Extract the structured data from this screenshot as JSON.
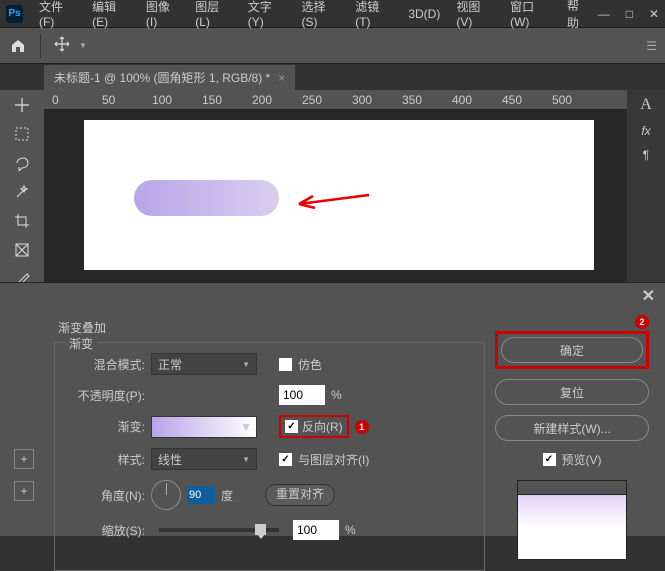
{
  "menu": {
    "file": "文件(F)",
    "edit": "编辑(E)",
    "image": "图像(I)",
    "layer": "图层(L)",
    "text": "文字(Y)",
    "select": "选择(S)",
    "filter": "滤镜(T)",
    "three_d": "3D(D)",
    "view": "视图(V)",
    "window": "窗口(W)",
    "help": "帮助"
  },
  "ps": "Ps",
  "tab_title": "未标题-1 @ 100% (圆角矩形 1, RGB/8) *",
  "ruler": {
    "r0": "0",
    "r50": "50",
    "r100": "100",
    "r150": "150",
    "r200": "200",
    "r250": "250",
    "r300": "300",
    "r350": "350",
    "r400": "400",
    "r450": "450",
    "r500": "500"
  },
  "right_icons": {
    "type": "A",
    "fx": "fx",
    "para": "¶"
  },
  "dialog": {
    "title": "渐变叠加",
    "legend": "渐变",
    "blend_mode_label": "混合模式:",
    "blend_mode_value": "正常",
    "dither_label": "仿色",
    "opacity_label": "不透明度(P):",
    "opacity_value": "100",
    "percent": "%",
    "gradient_label": "渐变:",
    "reverse_label": "反向(R)",
    "style_label": "样式:",
    "style_value": "线性",
    "align_label": "与图层对齐(I)",
    "angle_label": "角度(N):",
    "angle_value": "90",
    "degree": "度",
    "reset_align": "重置对齐",
    "scale_label": "缩放(S):",
    "scale_value": "100",
    "badge1": "1",
    "badge2": "2"
  },
  "buttons": {
    "ok": "确定",
    "reset": "复位",
    "new_style": "新建样式(W)...",
    "preview": "预览(V)"
  }
}
